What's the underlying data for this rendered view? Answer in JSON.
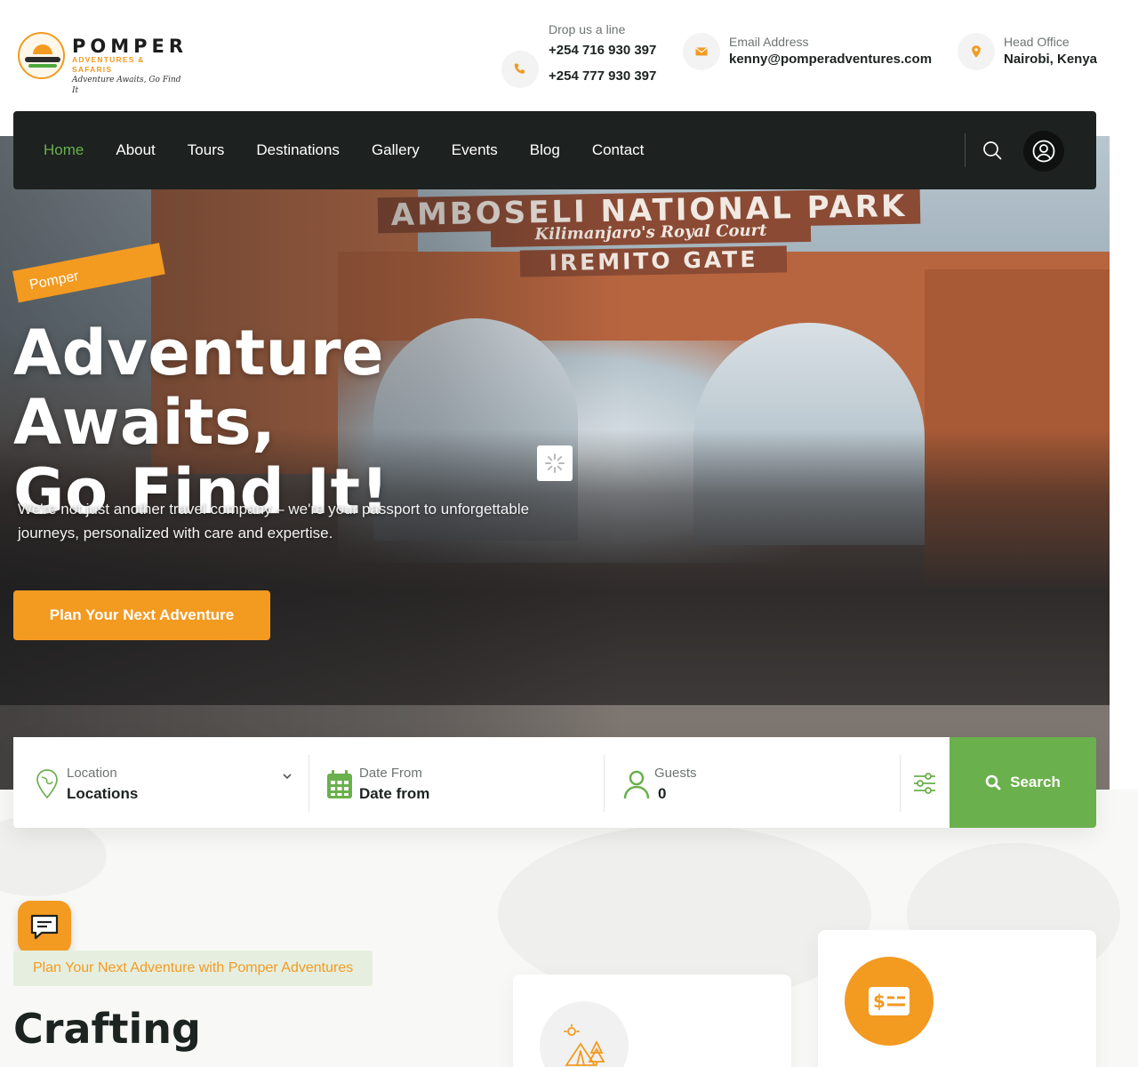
{
  "brand": {
    "name": "POMPER",
    "subtitle": "ADVENTURES & SAFARIS",
    "tagline": "Adventure Awaits, Go Find It"
  },
  "contacts": {
    "phone": {
      "label": "Drop us a line",
      "values": [
        "+254 716 930 397",
        "+254 777 930 397"
      ],
      "icon": "phone-icon"
    },
    "email": {
      "label": "Email Address",
      "value": "kenny@pomperadventures.com",
      "icon": "envelope-icon"
    },
    "office": {
      "label": "Head Office",
      "value": "Nairobi, Kenya",
      "icon": "map-pin-icon"
    }
  },
  "nav": {
    "items": [
      {
        "label": "Home",
        "active": true
      },
      {
        "label": "About",
        "active": false
      },
      {
        "label": "Tours",
        "active": false
      },
      {
        "label": "Destinations",
        "active": false
      },
      {
        "label": "Gallery",
        "active": false
      },
      {
        "label": "Events",
        "active": false
      },
      {
        "label": "Blog",
        "active": false
      },
      {
        "label": "Contact",
        "active": false
      }
    ]
  },
  "hero": {
    "sign": {
      "line1": "AMBOSELI  NATIONAL  PARK",
      "line2": "Kilimanjaro's   Royal   Court",
      "line3": "IREMITO   GATE"
    },
    "badge": "Pomper",
    "title_line1": "Adventure Awaits,",
    "title_line2": "Go Find It!",
    "description": "We're not just another travel company – we're your passport to unforgettable journeys, personalized with care and expertise.",
    "cta": "Plan Your Next Adventure"
  },
  "search": {
    "location": {
      "label": "Location",
      "value": "Locations"
    },
    "date": {
      "label": "Date From",
      "value": "Date from"
    },
    "guests": {
      "label": "Guests",
      "value": "0"
    },
    "button": "Search"
  },
  "section": {
    "tagline": "Plan Your Next Adventure with Pomper Adventures",
    "title": "Crafting"
  },
  "colors": {
    "accent_orange": "#f39a21",
    "accent_green": "#6ab04c",
    "nav_bg": "#1d2120",
    "text_dark": "#1c2321"
  }
}
